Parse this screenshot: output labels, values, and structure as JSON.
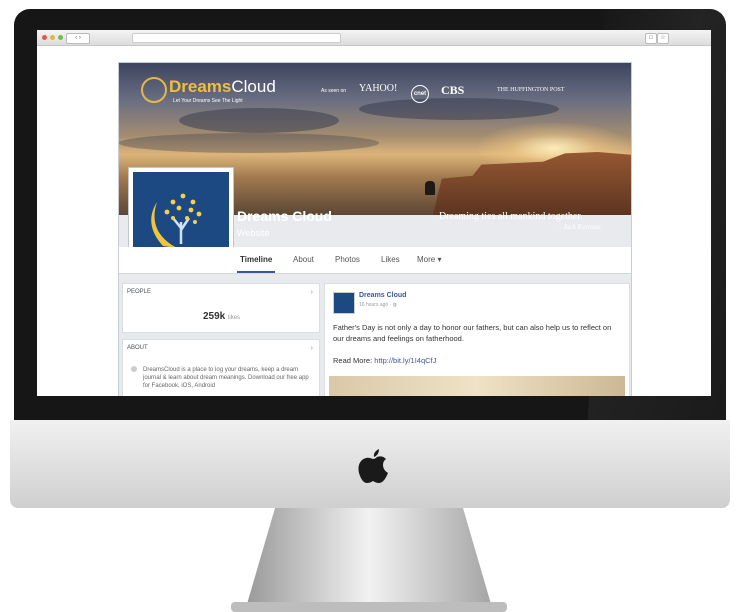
{
  "browser": {
    "nav_arrows": "‹ ›",
    "toolbar_icons": [
      "□",
      "☆"
    ]
  },
  "cover": {
    "brand_bold": "Dreams",
    "brand_light": "Cloud",
    "brand_tagline": "Let Your Dreams See The Light",
    "as_seen_on": "As seen on",
    "press": [
      "YAHOO!",
      "cnet",
      "CBS",
      "THE HUFFINGTON POST"
    ],
    "quote": "Dreaming ties all mankind together.",
    "quote_author": "- Jack Kerouac"
  },
  "profile": {
    "name": "Dreams Cloud",
    "category": "Website"
  },
  "tabs": [
    "Timeline",
    "About",
    "Photos",
    "Likes",
    "More ▾"
  ],
  "sidebar": {
    "people_label": "PEOPLE",
    "likes_count": "259k",
    "likes_word": "likes",
    "about_label": "ABOUT",
    "about_text": "DreamsCloud is a place to log your dreams, keep a dream journal & learn about dream meanings. Download our free app for Facebook, iOS, Android"
  },
  "post": {
    "author": "Dreams Cloud",
    "time": "16 hours ago ·",
    "text": "Father's Day is not only a day to honor our fathers, but can also help us to reflect on our dreams and feelings on fatherhood.",
    "read_more": "Read More: ",
    "link": "http://bit.ly/1I4qCfJ"
  },
  "colors": {
    "brand_gold": "#f2bd40",
    "facebook_blue": "#3b5998",
    "profile_navy": "#1d4983"
  }
}
